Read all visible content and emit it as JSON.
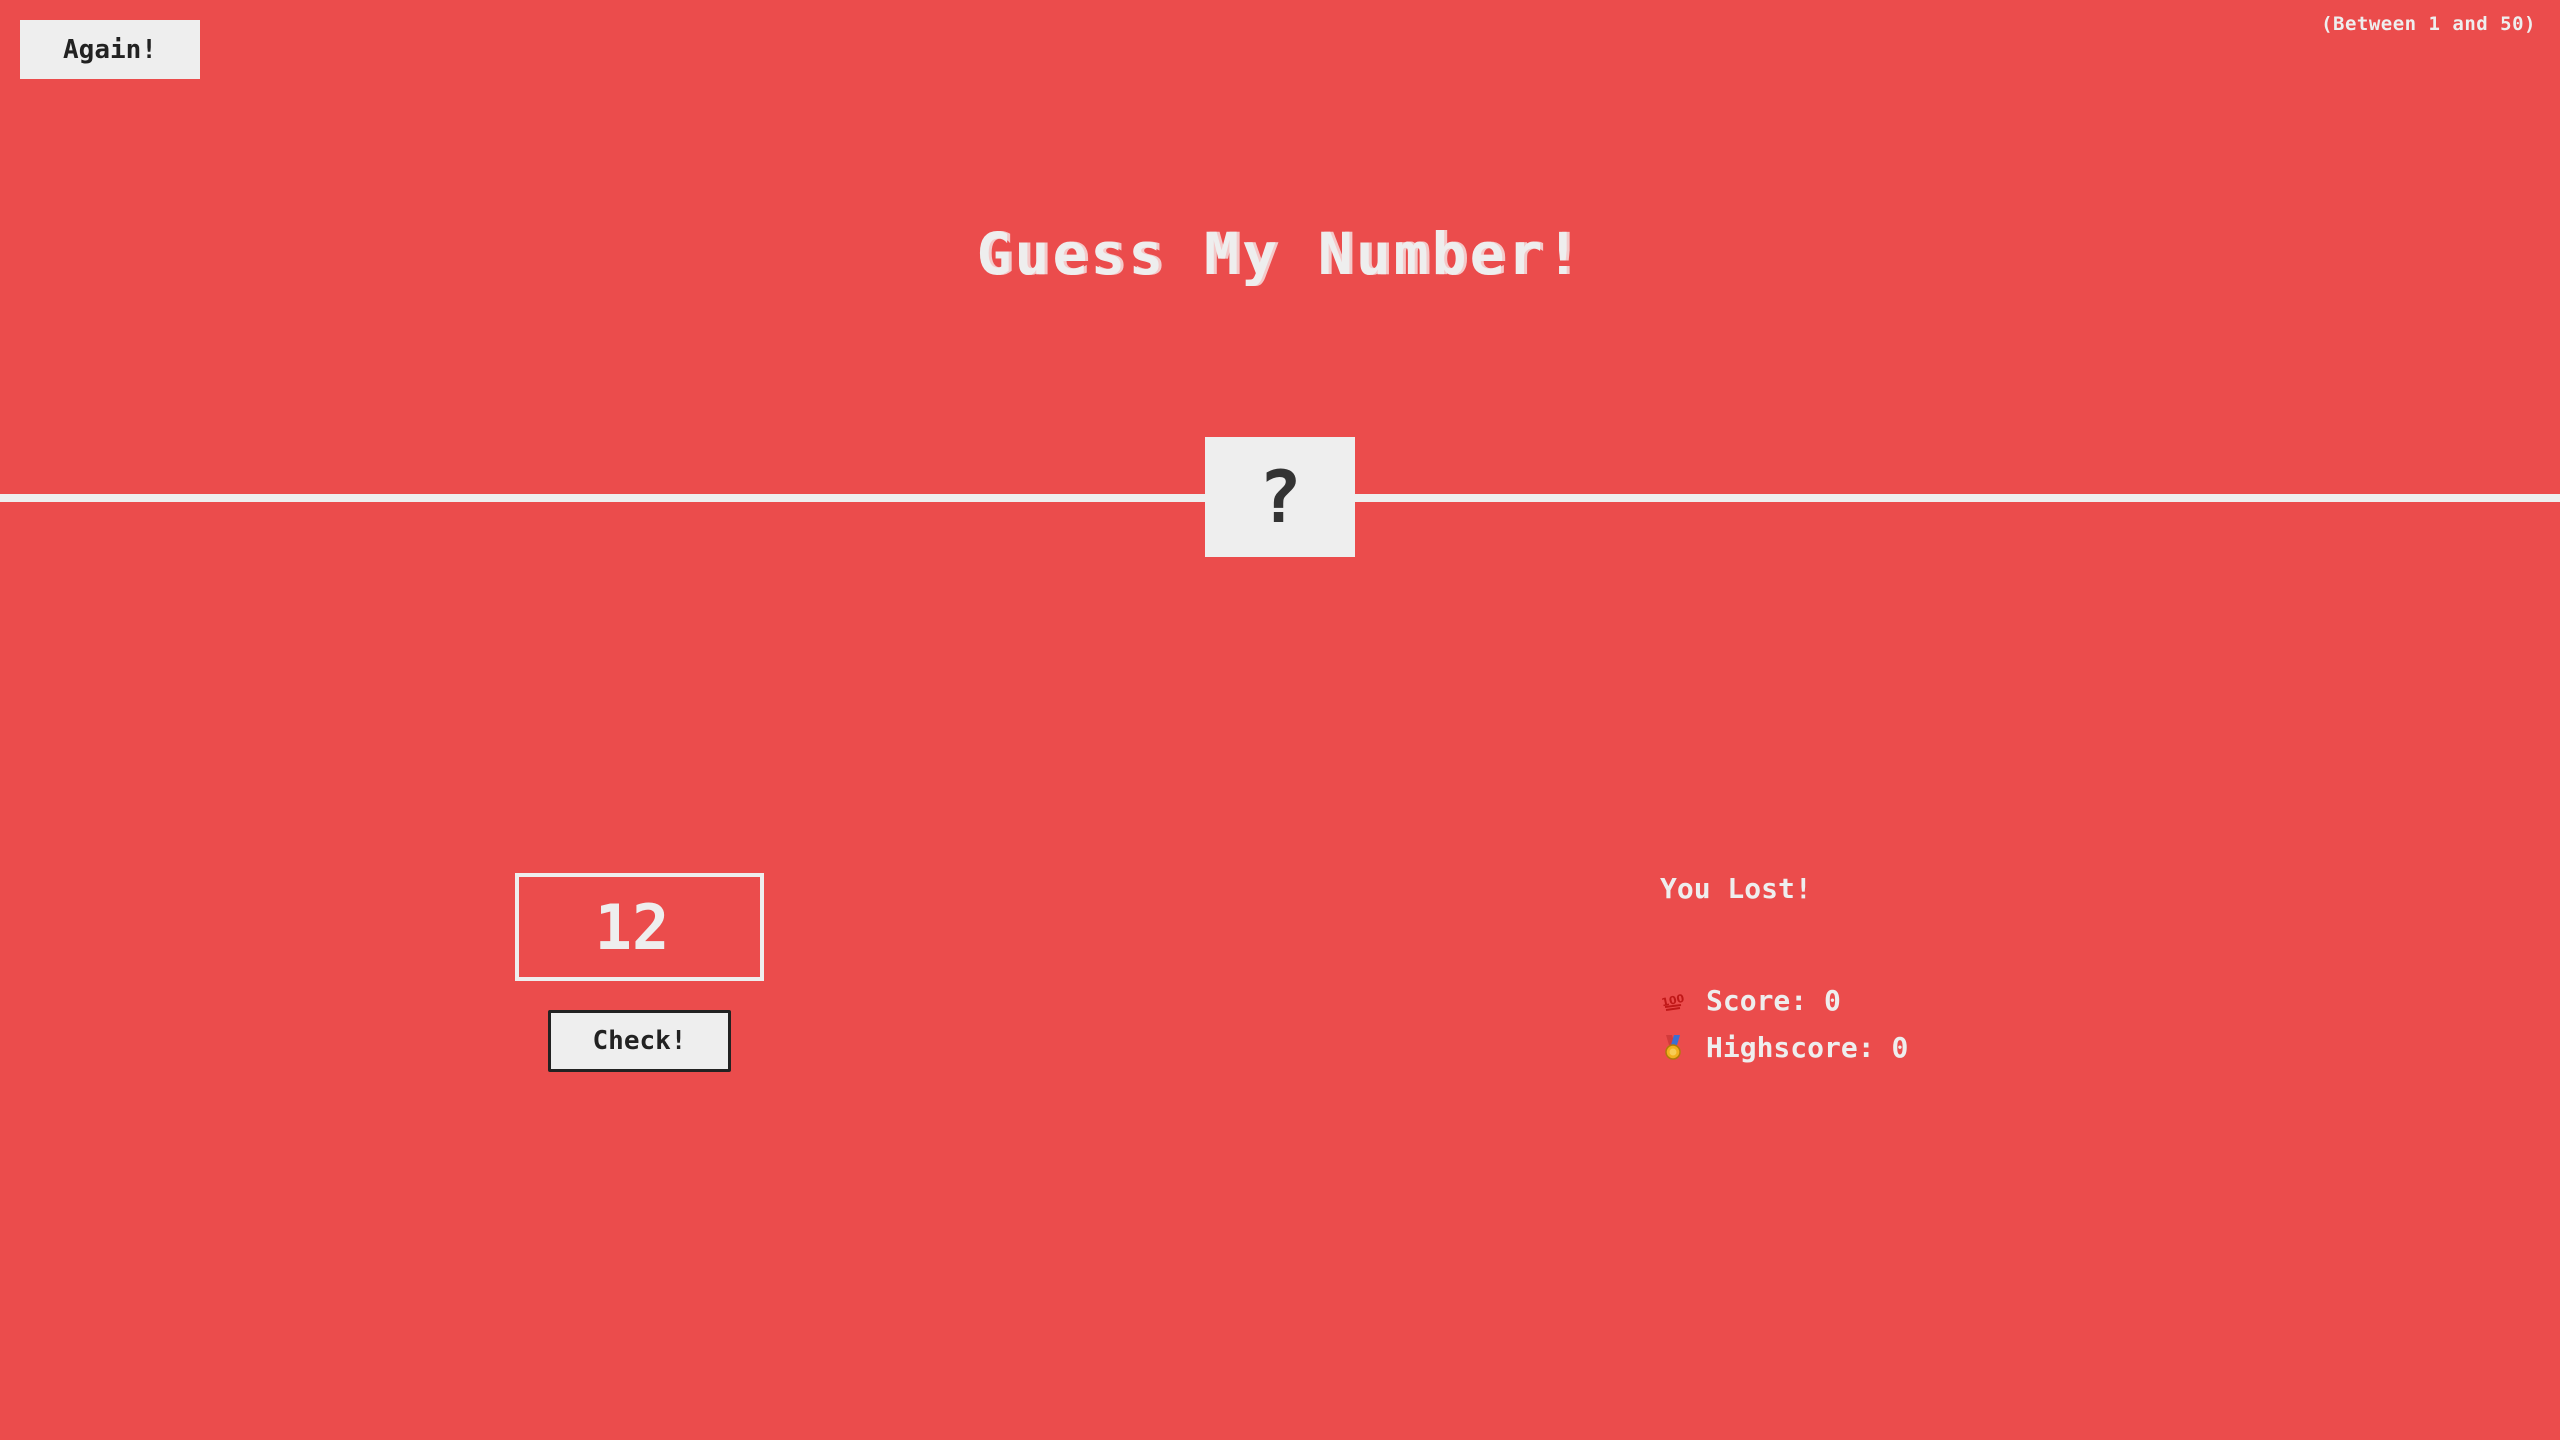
{
  "header": {
    "again_label": "Again!",
    "range_hint": "(Between 1 and 50)"
  },
  "title": "Guess My Number!",
  "secret": {
    "display": "?"
  },
  "left": {
    "guess_value": "12",
    "check_label": "Check!"
  },
  "right": {
    "message": "You Lost!",
    "score_label": "Score:",
    "score_value": "0",
    "highscore_label": "Highscore:",
    "highscore_value": "0",
    "score_icon": "hundred-points-icon",
    "highscore_icon": "medal-icon"
  },
  "colors": {
    "background": "#eb4c4c",
    "foreground": "#eeeeee",
    "dark": "#222222"
  }
}
